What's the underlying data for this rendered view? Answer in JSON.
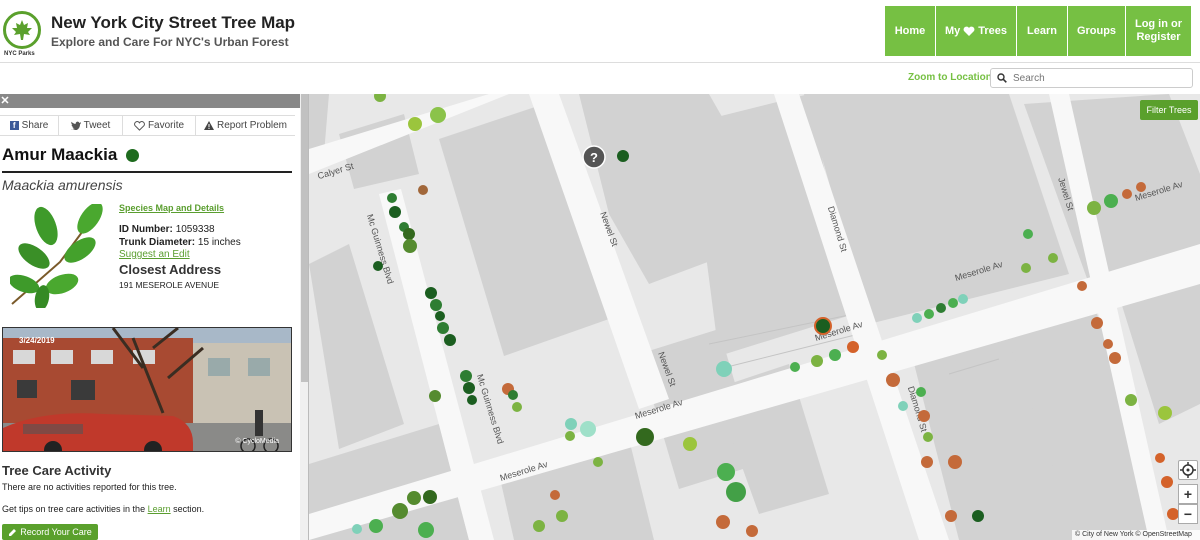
{
  "header": {
    "logo_text": "NYC Parks",
    "title": "New York City Street Tree Map",
    "subtitle": "Explore and Care For NYC's Urban Forest",
    "nav": [
      {
        "label": "Home"
      },
      {
        "label_prefix": "My",
        "label_suffix": "Trees",
        "icon": "heart-icon"
      },
      {
        "label": "Learn"
      },
      {
        "label": "Groups"
      },
      {
        "label": "Log in or Register"
      }
    ]
  },
  "toolbar": {
    "zoom_to_location": "Zoom to Location",
    "search_placeholder": "Search"
  },
  "panel": {
    "share_buttons": [
      {
        "label": "Share",
        "icon": "facebook-icon"
      },
      {
        "label": "Tweet",
        "icon": "twitter-icon"
      },
      {
        "label": "Favorite",
        "icon": "heart-outline-icon"
      },
      {
        "label": "Report Problem",
        "icon": "warning-icon"
      }
    ],
    "tree_name": "Amur Maackia",
    "scientific_name": "Maackia amurensis",
    "species_link": "Species Map and Details",
    "id_label": "ID Number:",
    "id_value": "1059338",
    "trunk_label": "Trunk Diameter:",
    "trunk_value": "15 inches",
    "suggest_edit": "Suggest an Edit",
    "closest_address_label": "Closest Address",
    "address": "191 MESEROLE AVENUE",
    "photo_date": "3/24/2019",
    "photo_credit": "© CycloMedia",
    "care_title": "Tree Care Activity",
    "care_none": "There are no activities reported for this tree.",
    "care_tips_prefix": "Get tips on tree care activities in the",
    "care_tips_link": "Learn",
    "care_tips_suffix": "section.",
    "record_button": "Record Your Care"
  },
  "map": {
    "filter_button": "Filter Trees",
    "attribution": "© City of New York © OpenStreetMap",
    "streets": [
      "Calyer St",
      "Mc Guinness Blvd",
      "Newel St",
      "Diamond St",
      "Meserole Av",
      "Jewel St"
    ],
    "colors": {
      "good": "#2e7d32",
      "fair": "#7cb342",
      "poor": "#d4622a",
      "stump": "#7fd1b9"
    }
  }
}
